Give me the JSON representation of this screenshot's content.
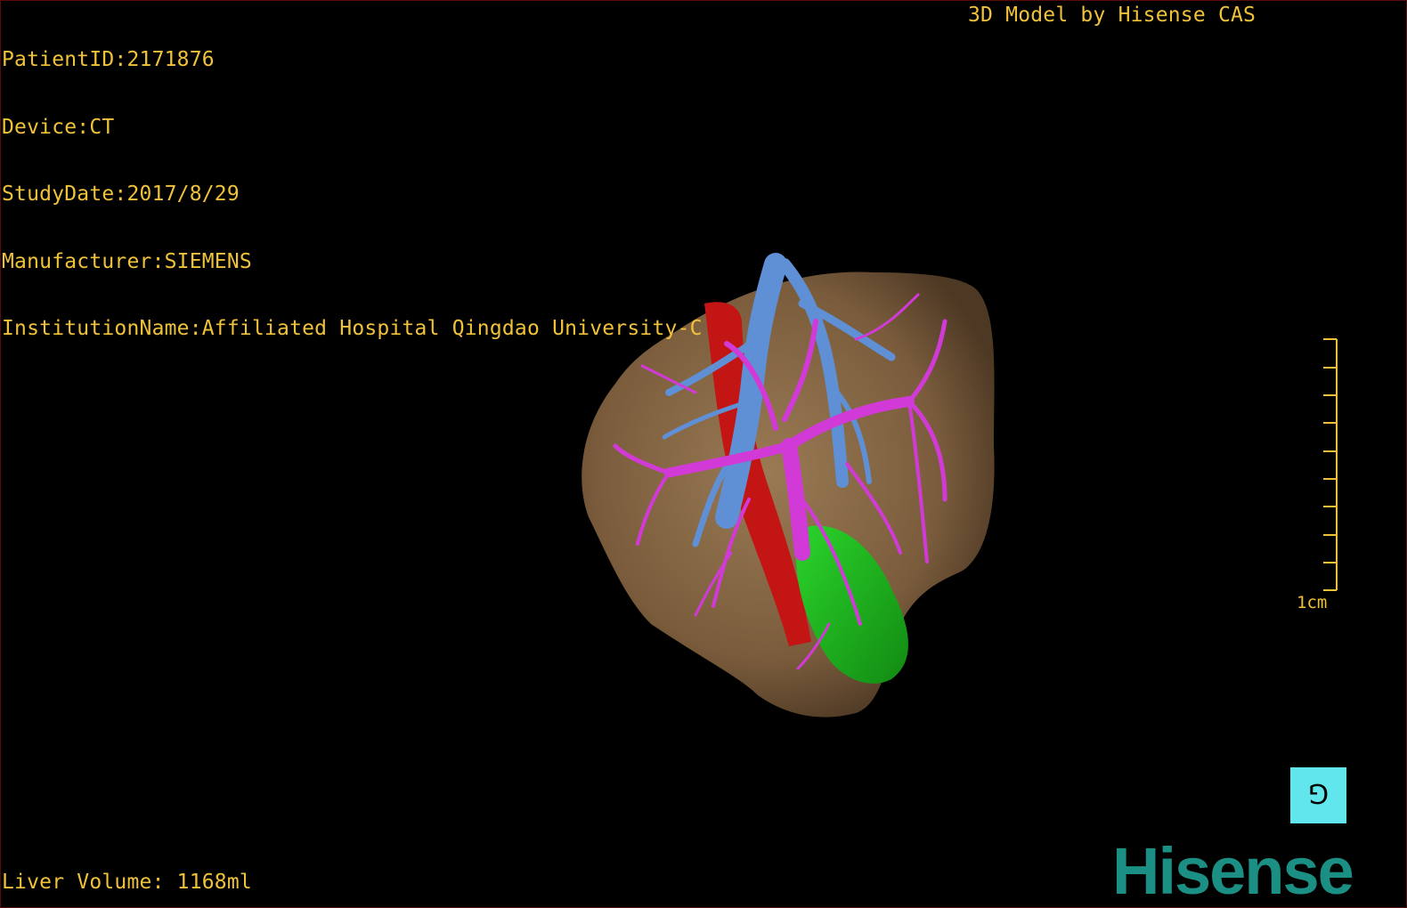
{
  "header": {
    "patient_id": "PatientID:2171876",
    "device": "Device:CT",
    "study_date": "StudyDate:2017/8/29",
    "manufacturer": "Manufacturer:SIEMENS",
    "institution": "InstitutionName:Affiliated Hospital Qingdao University-C",
    "model_credit": "3D Model by Hisense CAS"
  },
  "footer": {
    "liver_volume": "Liver Volume: 1168ml",
    "brand_logo": "Hisense"
  },
  "scale_bar": {
    "label": "1cm"
  },
  "orientation_button": {
    "icon": "orientation-icon",
    "glyph": "⅁"
  },
  "colors": {
    "overlay_text": "#f0c23a",
    "liver": "#7a5c3c",
    "hepatic_vein": "#5f8fd4",
    "portal_vein": "#d23ad8",
    "ivc": "#c41515",
    "gallbladder": "#1dbb1d",
    "orientation_button": "#62e6ee",
    "logo": "#1b8f83"
  }
}
